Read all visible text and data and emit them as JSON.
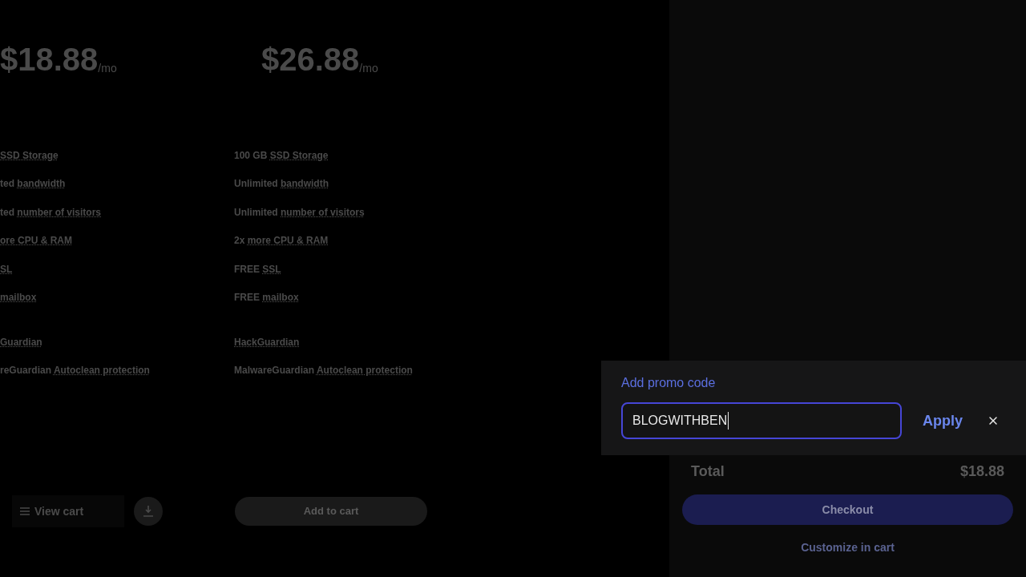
{
  "plans": [
    {
      "price": "$18.88",
      "period": "/mo",
      "features": [
        {
          "term": "SSD Storage"
        },
        {
          "prefix": "ted",
          "term": "bandwidth"
        },
        {
          "prefix": "ted",
          "term": "number of visitors"
        },
        {
          "term": "ore CPU & RAM"
        },
        {
          "term": "SL"
        },
        {
          "term": "mailbox"
        },
        {
          "term": "Guardian"
        },
        {
          "prefix": "reGuardian",
          "term": "Autoclean protection"
        }
      ],
      "action": {
        "kind": "view_cart",
        "label": "View cart"
      }
    },
    {
      "price": "$26.88",
      "period": "/mo",
      "features": [
        {
          "prefix": "100 GB",
          "term": "SSD Storage"
        },
        {
          "prefix": "Unlimited",
          "term": "bandwidth"
        },
        {
          "prefix": "Unlimited",
          "term": "number of visitors"
        },
        {
          "prefix": "2x",
          "term": "more CPU & RAM"
        },
        {
          "prefix": "FREE",
          "term": "SSL"
        },
        {
          "prefix": "FREE",
          "term": "mailbox"
        },
        {
          "term": "HackGuardian"
        },
        {
          "prefix": "MalwareGuardian",
          "term": "Autoclean protection"
        }
      ],
      "action": {
        "kind": "add_to_cart",
        "label": "Add to cart"
      }
    }
  ],
  "cart_panel": {
    "total_label": "Total",
    "total": "$18.88",
    "checkout": "Checkout",
    "customize": "Customize in cart"
  },
  "promo_popover": {
    "title": "Add promo code",
    "field": {
      "value": "BLOGWITHBEN",
      "focused": true
    },
    "apply": "Apply"
  }
}
